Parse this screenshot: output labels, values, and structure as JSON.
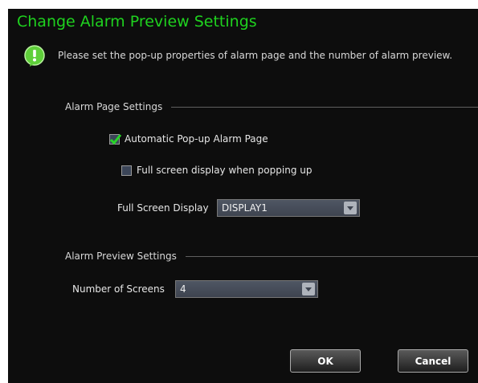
{
  "dialog": {
    "title": "Change Alarm Preview Settings",
    "info_text": "Please set the pop-up properties of alarm page and the number of alarm preview."
  },
  "alarm_page": {
    "title": "Alarm Page Settings",
    "auto_popup_label": "Automatic Pop-up Alarm Page",
    "auto_popup_checked": true,
    "fullscreen_label": "Full screen display when popping up",
    "fullscreen_checked": false,
    "display_label": "Full Screen Display",
    "display_value": "DISPLAY1"
  },
  "alarm_preview": {
    "title": "Alarm Preview Settings",
    "screens_label": "Number of Screens",
    "screens_value": "4"
  },
  "buttons": {
    "ok": "OK",
    "cancel": "Cancel"
  },
  "colors": {
    "title": "#1fd21f",
    "background": "#0d0d0d",
    "check": "#27d627"
  }
}
